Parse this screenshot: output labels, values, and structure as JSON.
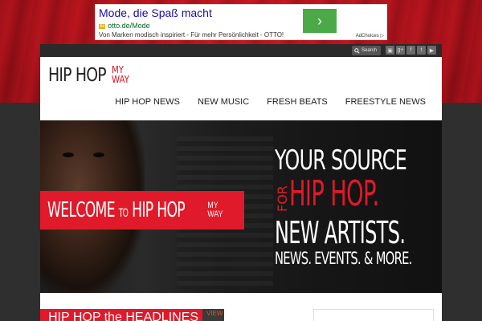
{
  "ad": {
    "headline": "Mode, die Spaß macht",
    "url": "otto.de/Mode",
    "url_mark": "Ad",
    "description": "Von Marken modisch inspiriert - Für mehr Persönlichkeit - OTTO!",
    "arrow": "›",
    "adchoices": "AdChoices ▷"
  },
  "topbar": {
    "search_label": "Search",
    "search_icon": "magnifier-icon",
    "social_icons": [
      "instagram-icon",
      "google-plus-icon",
      "facebook-icon",
      "twitter-icon",
      "youtube-icon"
    ],
    "social_glyphs": [
      "▣",
      "g+",
      "f",
      "t",
      "▶"
    ]
  },
  "header": {
    "logo_main": "HIP HOP",
    "logo_sub_1": "MY",
    "logo_sub_2": "WAY"
  },
  "nav": {
    "items": [
      "HIP HOP NEWS",
      "NEW MUSIC",
      "FRESH BEATS",
      "FREESTYLE NEWS"
    ]
  },
  "hero": {
    "welcome_1": "WELCOME",
    "welcome_to": "TO",
    "welcome_2": "HIP HOP",
    "welcome_my": "MY",
    "welcome_way": "WAY",
    "tag_1": "YOUR SOURCE",
    "tag_for": "FOR",
    "tag_hiphop": "HIP HOP.",
    "tag_3": "NEW ARTISTS.",
    "tag_4": "NEWS. EVENTS. & MORE."
  },
  "lower": {
    "headline_label": "HIP HOP the HEADLINES",
    "view_label": "VIEW"
  },
  "colors": {
    "brand_red": "#e01a2a",
    "ad_green": "#4ca947"
  }
}
